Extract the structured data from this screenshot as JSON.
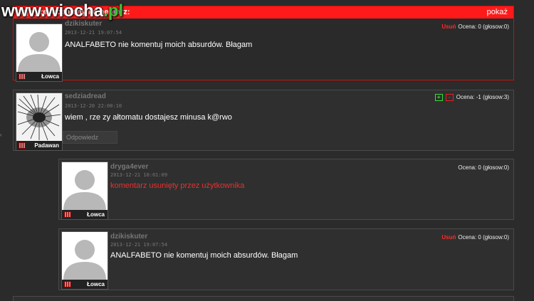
{
  "top_bar": {
    "title": "Najwyżej oceniony komentarz:",
    "show_label": "pokaż"
  },
  "watermark": {
    "name": "www.wiocha",
    "suffix": ".pl"
  },
  "side_arrow": "‹",
  "comments": [
    {
      "user": "dzikiskuter",
      "date": "2013-12-21 19:07:54",
      "text": "ANALFABETO nie komentuj moich absurdów. Błagam",
      "delete_label": "Usuń",
      "rating_label": "Ocena: 0 (głosow:0)",
      "rank": "Łowca",
      "avatar": "default-avatar"
    },
    {
      "user": "sedziadread",
      "date": "2013-12-20 22:00:10",
      "text": "wiem , rze zy ałtomatu dostajesz minusa k@rwo",
      "rating_label": "Ocena: -1 (głosow:3)",
      "vote_plus": "+",
      "vote_minus": "-",
      "reply_label": "Odpowiedz",
      "rank": "Padawan",
      "avatar": "feather-avatar"
    },
    {
      "user": "dryga4ever",
      "date": "2013-12-21 10:01:09",
      "text": "komentarz usunięty przez użytkownika",
      "rating_label": "Ocena: 0 (głosow:0)",
      "rank": "Łowca",
      "avatar": "default-avatar"
    },
    {
      "user": "dzikiskuter",
      "date": "2013-12-21 19:07:54",
      "text": "ANALFABETO nie komentuj moich absurdów. Błagam",
      "delete_label": "Usuń",
      "rating_label": "Ocena: 0 (głosow:0)",
      "rank": "Łowca",
      "avatar": "default-avatar"
    }
  ]
}
